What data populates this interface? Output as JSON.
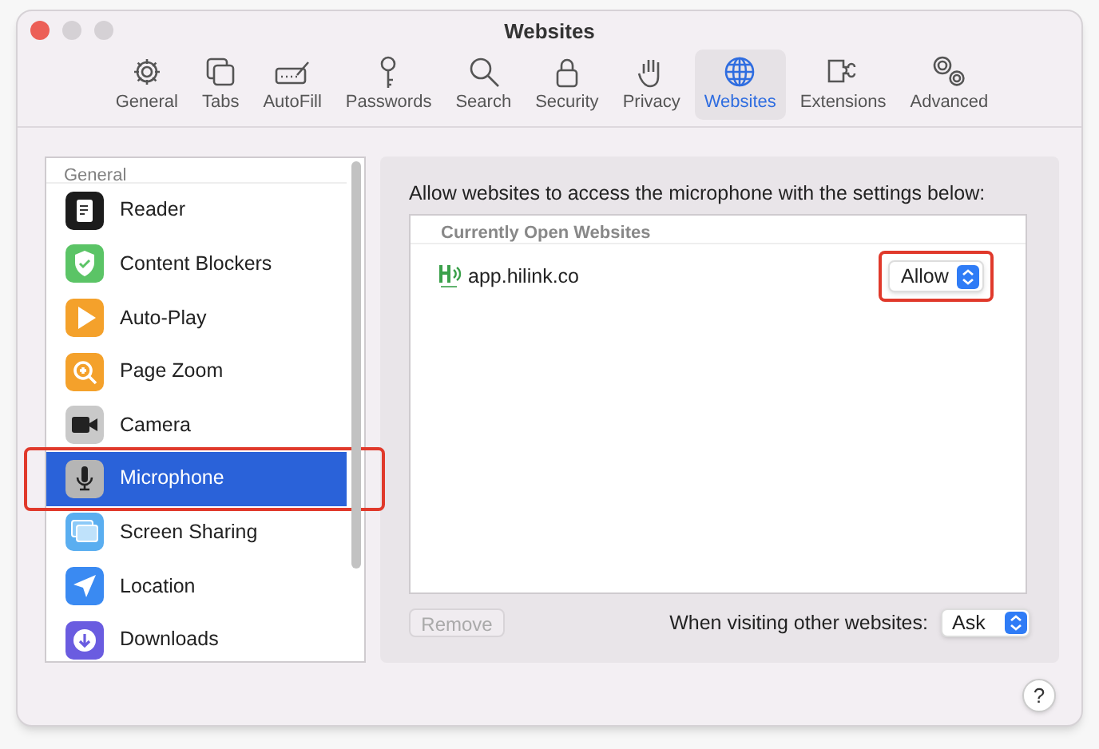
{
  "window": {
    "title": "Websites"
  },
  "tabs": [
    {
      "label": "General",
      "selected": false
    },
    {
      "label": "Tabs",
      "selected": false
    },
    {
      "label": "AutoFill",
      "selected": false
    },
    {
      "label": "Passwords",
      "selected": false
    },
    {
      "label": "Search",
      "selected": false
    },
    {
      "label": "Security",
      "selected": false
    },
    {
      "label": "Privacy",
      "selected": false
    },
    {
      "label": "Websites",
      "selected": true
    },
    {
      "label": "Extensions",
      "selected": false
    },
    {
      "label": "Advanced",
      "selected": false
    }
  ],
  "sidebar": {
    "section": "General",
    "items": [
      {
        "label": "Reader",
        "selected": false,
        "highlighted": false
      },
      {
        "label": "Content Blockers",
        "selected": false,
        "highlighted": false
      },
      {
        "label": "Auto-Play",
        "selected": false,
        "highlighted": false
      },
      {
        "label": "Page Zoom",
        "selected": false,
        "highlighted": false
      },
      {
        "label": "Camera",
        "selected": false,
        "highlighted": false
      },
      {
        "label": "Microphone",
        "selected": true,
        "highlighted": true
      },
      {
        "label": "Screen Sharing",
        "selected": false,
        "highlighted": false
      },
      {
        "label": "Location",
        "selected": false,
        "highlighted": false
      },
      {
        "label": "Downloads",
        "selected": false,
        "highlighted": false
      }
    ]
  },
  "content": {
    "description": "Allow websites to access the microphone with the settings below:",
    "table_header": "Currently Open Websites",
    "sites": [
      {
        "domain": "app.hilink.co",
        "permission": "Allow",
        "highlighted": true
      }
    ],
    "remove_button": {
      "label": "Remove",
      "disabled": true
    },
    "other_websites": {
      "label": "When visiting other websites:",
      "value": "Ask"
    }
  },
  "help": "?"
}
